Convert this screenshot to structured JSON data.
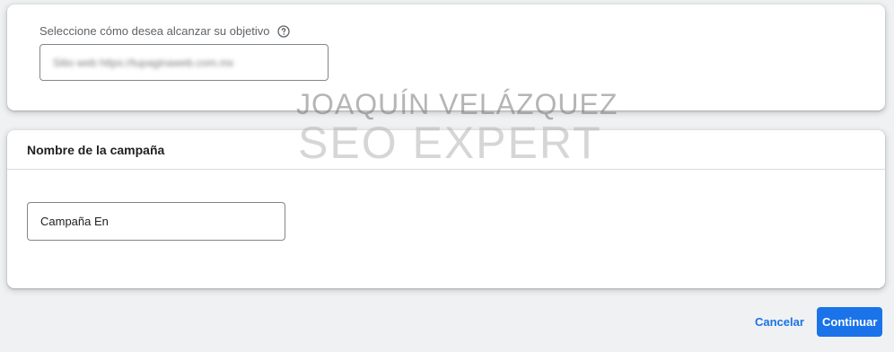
{
  "objective": {
    "label": "Seleccione cómo desea alcanzar su objetivo",
    "help_icon": "help-circle-icon",
    "url_value": "Sitio web  https://tupaginaweb.com.mx"
  },
  "campaign": {
    "title": "Nombre de la campaña",
    "name_value": "Campaña En"
  },
  "watermark": {
    "line1": "JOAQUÍN VELÁZQUEZ",
    "line2": "SEO EXPERT"
  },
  "actions": {
    "cancel_label": "Cancelar",
    "continue_label": "Continuar"
  },
  "colors": {
    "accent": "#1a73e8",
    "background": "#eff1f2"
  }
}
